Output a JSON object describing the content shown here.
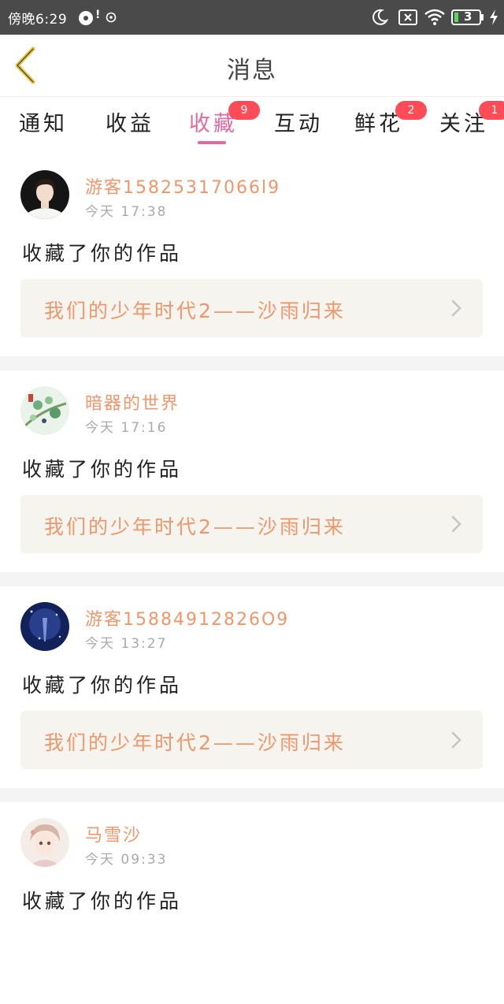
{
  "status_bar": {
    "time": "傍晚6:29",
    "notification_badge": "!",
    "battery_level": "3"
  },
  "header": {
    "title": "消息"
  },
  "tabs": [
    {
      "label": "通知",
      "badge": ""
    },
    {
      "label": "收益",
      "badge": ""
    },
    {
      "label": "收藏",
      "badge": "9",
      "active": true
    },
    {
      "label": "互动",
      "badge": ""
    },
    {
      "label": "鲜花",
      "badge": "2"
    },
    {
      "label": "关注",
      "badge": "1"
    }
  ],
  "messages": [
    {
      "user": "游客15825317066l9",
      "time": "今天 17:38",
      "action": "收藏了你的作品",
      "work": "我们的少年时代2——沙雨归来"
    },
    {
      "user": "暗器的世界",
      "time": "今天 17:16",
      "action": "收藏了你的作品",
      "work": "我们的少年时代2——沙雨归来"
    },
    {
      "user": "游客15884912826O9",
      "time": "今天 13:27",
      "action": "收藏了你的作品",
      "work": "我们的少年时代2——沙雨归来"
    },
    {
      "user": "马雪沙",
      "time": "今天 09:33",
      "action": "收藏了你的作品",
      "work": ""
    }
  ],
  "colors": {
    "accent_pink": "#e16aa2",
    "name_orange": "#f0966b",
    "badge_red": "#ff4c57",
    "status_bar": "#4a4a4a",
    "work_box_bg": "#f5f4ee"
  }
}
